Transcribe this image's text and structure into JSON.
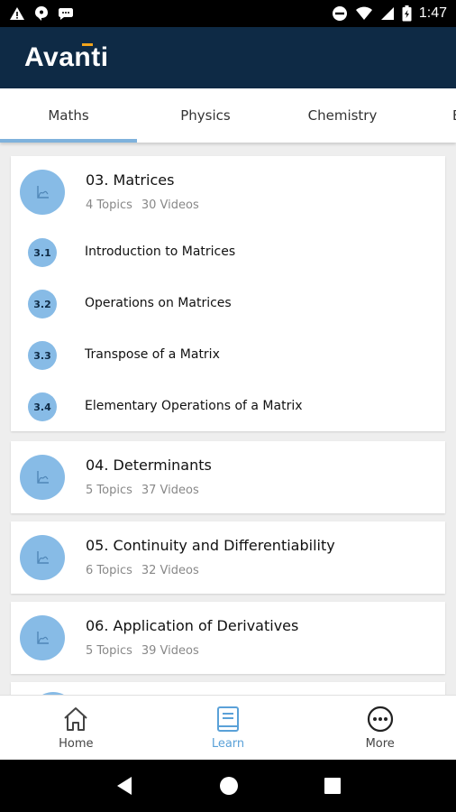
{
  "status_bar": {
    "time": "1:47"
  },
  "app": {
    "logo": "Avanti"
  },
  "tabs": [
    {
      "label": "Maths",
      "active": true
    },
    {
      "label": "Physics",
      "active": false
    },
    {
      "label": "Chemistry",
      "active": false
    },
    {
      "label": "B",
      "active": false
    }
  ],
  "chapters": [
    {
      "title": "03. Matrices",
      "topics_count": "4 Topics",
      "videos_count": "30 Videos",
      "topics": [
        {
          "number": "3.1",
          "label": "Introduction to Matrices"
        },
        {
          "number": "3.2",
          "label": "Operations on Matrices"
        },
        {
          "number": "3.3",
          "label": "Transpose of a Matrix"
        },
        {
          "number": "3.4",
          "label": "Elementary Operations of a Matrix"
        }
      ]
    },
    {
      "title": "04. Determinants",
      "topics_count": "5 Topics",
      "videos_count": "37 Videos"
    },
    {
      "title": "05. Continuity and Differentiability",
      "topics_count": "6 Topics",
      "videos_count": "32 Videos"
    },
    {
      "title": "06. Application of Derivatives",
      "topics_count": "5 Topics",
      "videos_count": "39 Videos"
    }
  ],
  "bottom_nav": [
    {
      "label": "Home",
      "icon": "home-icon",
      "active": false
    },
    {
      "label": "Learn",
      "icon": "book-icon",
      "active": true
    },
    {
      "label": "More",
      "icon": "more-icon",
      "active": false
    }
  ],
  "colors": {
    "app_bar": "#0e2a45",
    "accent": "#87bbe6",
    "active_tab": "#7fb2dc",
    "active_nav": "#5aa1d8",
    "logo_accent": "#f2a31b"
  }
}
